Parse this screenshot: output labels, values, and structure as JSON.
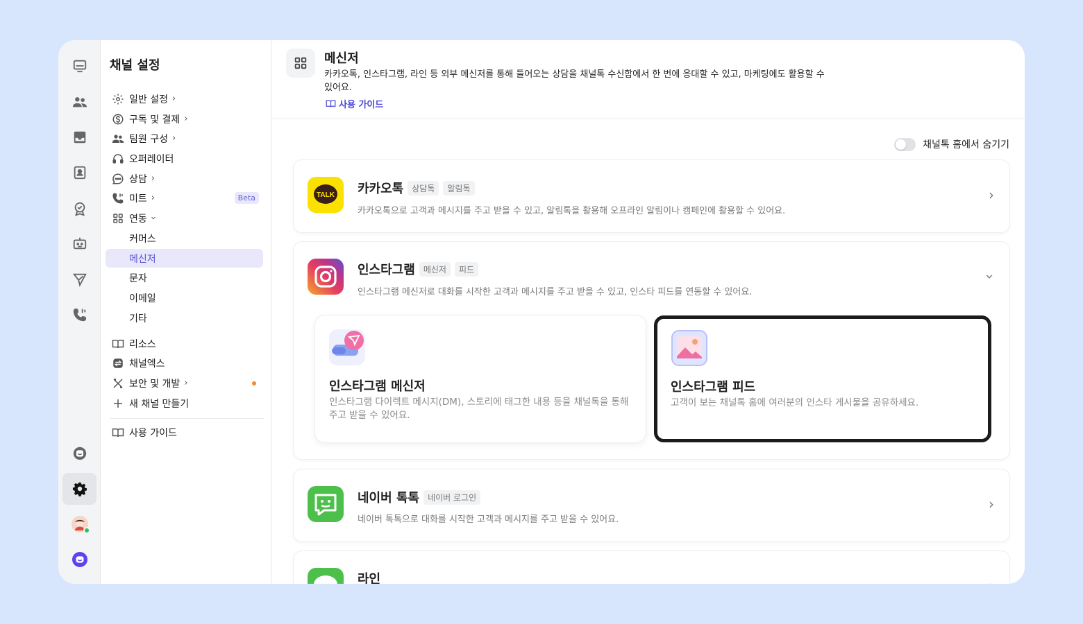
{
  "sidebar": {
    "title": "채널 설정",
    "items": [
      {
        "label": "일반 설정"
      },
      {
        "label": "구독 및 결제"
      },
      {
        "label": "팀원 구성"
      },
      {
        "label": "오퍼레이터"
      },
      {
        "label": "상담"
      },
      {
        "label": "미트",
        "badge": "Beta"
      },
      {
        "label": "연동"
      },
      {
        "label": "커머스"
      },
      {
        "label": "메신저"
      },
      {
        "label": "문자"
      },
      {
        "label": "이메일"
      },
      {
        "label": "기타"
      },
      {
        "label": "리소스"
      },
      {
        "label": "채널엑스"
      },
      {
        "label": "보안 및 개발"
      },
      {
        "label": "새 채널 만들기"
      },
      {
        "label": "사용 가이드"
      }
    ]
  },
  "header": {
    "title": "메신저",
    "description": "카카오톡, 인스타그램, 라인 등 외부 메신저를 통해 들어오는 상담을 채널톡 수신함에서 한 번에 응대할 수 있고, 마케팅에도 활용할 수 있어요.",
    "guide_link": "사용 가이드"
  },
  "toggle": {
    "label": "채널톡 홈에서 숨기기",
    "on": false
  },
  "cards": {
    "kakao": {
      "title": "카카오톡",
      "tags": [
        "상담톡",
        "알림톡"
      ],
      "description": "카카오톡으로 고객과 메시지를 주고 받을 수 있고, 알림톡을 활용해 오프라인 알림이나 캠페인에 활용할 수 있어요.",
      "logo_text": "TALK"
    },
    "instagram": {
      "title": "인스타그램",
      "tags": [
        "메신저",
        "피드"
      ],
      "description": "인스타그램 메신저로 대화를 시작한 고객과 메시지를 주고 받을 수 있고, 인스타 피드를 연동할 수 있어요.",
      "messenger": {
        "title": "인스타그램 메신저",
        "description": "인스타그램 다이렉트 메시지(DM), 스토리에 태그한 내용 등을 채널톡을 통해 주고 받을 수 있어요."
      },
      "feed": {
        "title": "인스타그램 피드",
        "description": "고객이 보는 채널톡 홈에 여러분의 인스타 게시물을 공유하세요."
      }
    },
    "naver": {
      "title": "네이버 톡톡",
      "tags": [
        "네이버 로그인"
      ],
      "description": "네이버 톡톡으로 대화를 시작한 고객과 메시지를 주고 받을 수 있어요."
    },
    "line": {
      "title": "라인"
    }
  },
  "colors": {
    "accent": "#5b54d6",
    "kakao": "#fae100",
    "naver": "#2db400",
    "line": "#06c755",
    "background": "#d8e6fd"
  }
}
